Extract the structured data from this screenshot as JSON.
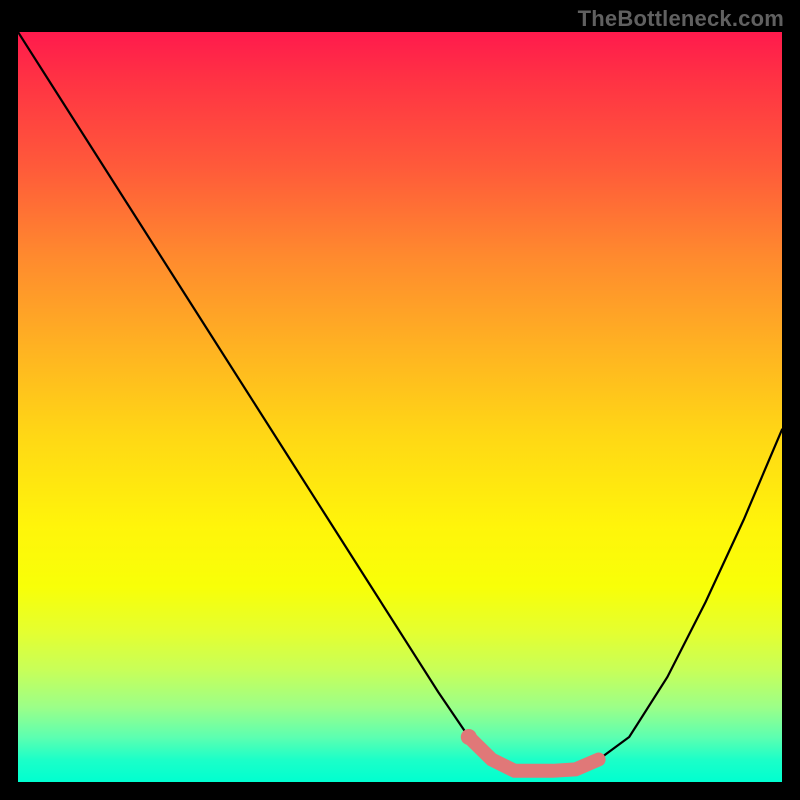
{
  "watermark": "TheBottleneck.com",
  "chart_data": {
    "type": "line",
    "title": "",
    "xlabel": "",
    "ylabel": "",
    "xlim": [
      0,
      100
    ],
    "ylim": [
      0,
      100
    ],
    "series": [
      {
        "name": "bottleneck-curve",
        "x": [
          0,
          5,
          10,
          15,
          20,
          25,
          30,
          35,
          40,
          45,
          50,
          55,
          59,
          62,
          65,
          67,
          70,
          73,
          76,
          80,
          85,
          90,
          95,
          100
        ],
        "values": [
          100,
          92,
          84,
          76,
          68,
          60,
          52,
          44,
          36,
          28,
          20,
          12,
          6,
          3,
          1.5,
          1.5,
          1.5,
          1.7,
          3,
          6,
          14,
          24,
          35,
          47
        ]
      }
    ],
    "annotations": [
      {
        "name": "flat-minimum-highlight",
        "x_start": 59,
        "x_end": 76,
        "y": 1.7,
        "color": "#e07878"
      }
    ],
    "background_gradient": {
      "top": "#ff1a4d",
      "mid": "#ffd815",
      "bottom": "#00ffd0"
    }
  }
}
